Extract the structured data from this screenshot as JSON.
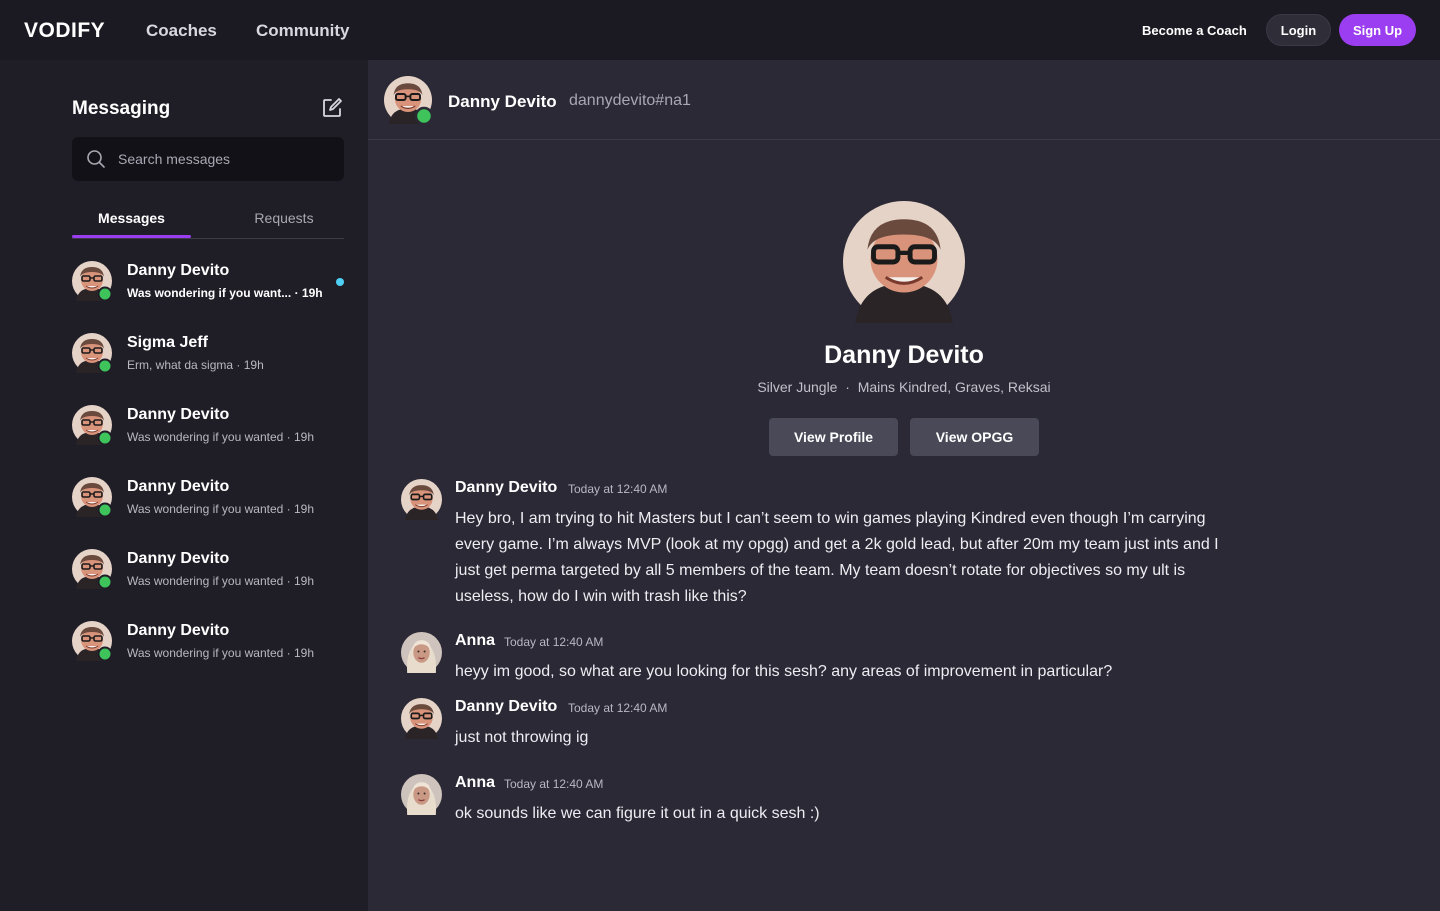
{
  "nav": {
    "logo": "VODIFY",
    "links": [
      "Coaches",
      "Community"
    ],
    "become_coach": "Become a Coach",
    "login": "Login",
    "signup": "Sign Up"
  },
  "sidebar": {
    "title": "Messaging",
    "search_placeholder": "Search messages",
    "tabs": [
      "Messages",
      "Requests"
    ],
    "conversations": [
      {
        "name": "Danny Devito",
        "preview": "Was wondering if you want...",
        "time": "19h",
        "unread": true
      },
      {
        "name": "Sigma Jeff",
        "preview": "Erm, what da sigma",
        "time": "19h",
        "unread": false
      },
      {
        "name": "Danny Devito",
        "preview": "Was wondering if you wanted",
        "time": "19h",
        "unread": false
      },
      {
        "name": "Danny Devito",
        "preview": "Was wondering if you wanted",
        "time": "19h",
        "unread": false
      },
      {
        "name": "Danny Devito",
        "preview": "Was wondering if you wanted",
        "time": "19h",
        "unread": false
      },
      {
        "name": "Danny Devito",
        "preview": "Was wondering if you wanted",
        "time": "19h",
        "unread": false
      }
    ]
  },
  "chat": {
    "header_name": "Danny Devito",
    "header_handle": "dannydevito#na1",
    "profile": {
      "name": "Danny Devito",
      "rank": "Silver Jungle",
      "mains": "Mains Kindred, Graves, Reksai",
      "view_profile": "View Profile",
      "view_opgg": "View OPGG"
    },
    "messages": [
      {
        "author": "Danny Devito",
        "time": "Today at 12:40 AM",
        "text": "Hey bro, I am trying to hit Masters but I can’t seem to win games playing Kindred even though I’m carrying every game. I’m always MVP (look at my opgg) and get a 2k gold lead, but after 20m my team just ints and I just get perma targeted by all 5 members of the team. My team doesn’t rotate for objectives so my ult is useless, how do I win with trash like this?"
      },
      {
        "author": "Anna",
        "time": "Today at 12:40 AM",
        "text": "heyy im good, so what are you looking for this sesh? any areas of improvement in particular?"
      },
      {
        "author": "Danny Devito",
        "time": "Today at 12:40 AM",
        "text": "just not throwing ig"
      },
      {
        "author": "Anna",
        "time": "Today at 12:40 AM",
        "text": "ok sounds like we can figure it out in a quick sesh :)"
      }
    ]
  },
  "colors": {
    "accent": "#9b3df0",
    "online": "#3ec45a",
    "unread": "#4fd1f5"
  }
}
